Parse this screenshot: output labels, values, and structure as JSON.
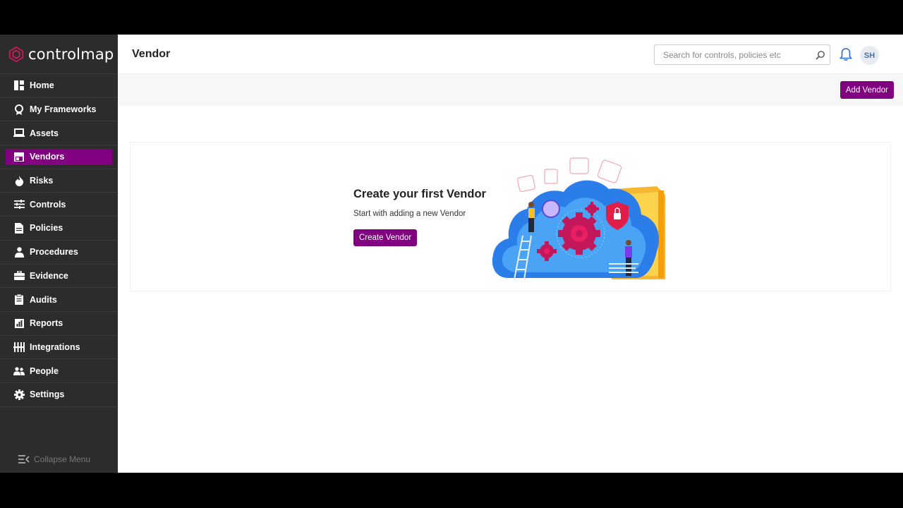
{
  "app": {
    "brand": "controlmap",
    "page_title": "Vendor"
  },
  "sidebar": {
    "items": [
      {
        "label": "Home",
        "icon": "home-icon",
        "active": false
      },
      {
        "label": "My Frameworks",
        "icon": "framework-icon",
        "active": false
      },
      {
        "label": "Assets",
        "icon": "laptop-icon",
        "active": false
      },
      {
        "label": "Vendors",
        "icon": "store-icon",
        "active": true
      },
      {
        "label": "Risks",
        "icon": "fire-icon",
        "active": false
      },
      {
        "label": "Controls",
        "icon": "sliders-icon",
        "active": false
      },
      {
        "label": "Policies",
        "icon": "document-icon",
        "active": false
      },
      {
        "label": "Procedures",
        "icon": "person-icon",
        "active": false
      },
      {
        "label": "Evidence",
        "icon": "briefcase-icon",
        "active": false
      },
      {
        "label": "Audits",
        "icon": "clipboard-icon",
        "active": false
      },
      {
        "label": "Reports",
        "icon": "chart-icon",
        "active": false
      },
      {
        "label": "Integrations",
        "icon": "integrations-icon",
        "active": false
      },
      {
        "label": "People",
        "icon": "people-icon",
        "active": false
      },
      {
        "label": "Settings",
        "icon": "gear-icon",
        "active": false
      }
    ],
    "collapse_label": "Collapse Menu"
  },
  "header": {
    "search_placeholder": "Search for controls, policies etc",
    "avatar_initials": "SH"
  },
  "toolbar": {
    "add_label": "Add Vendor"
  },
  "empty_state": {
    "title": "Create your first Vendor",
    "subtitle": "Start with adding a new Vendor",
    "button_label": "Create Vendor"
  },
  "colors": {
    "accent": "#800080",
    "sidebar_bg": "#2c2c2c"
  }
}
